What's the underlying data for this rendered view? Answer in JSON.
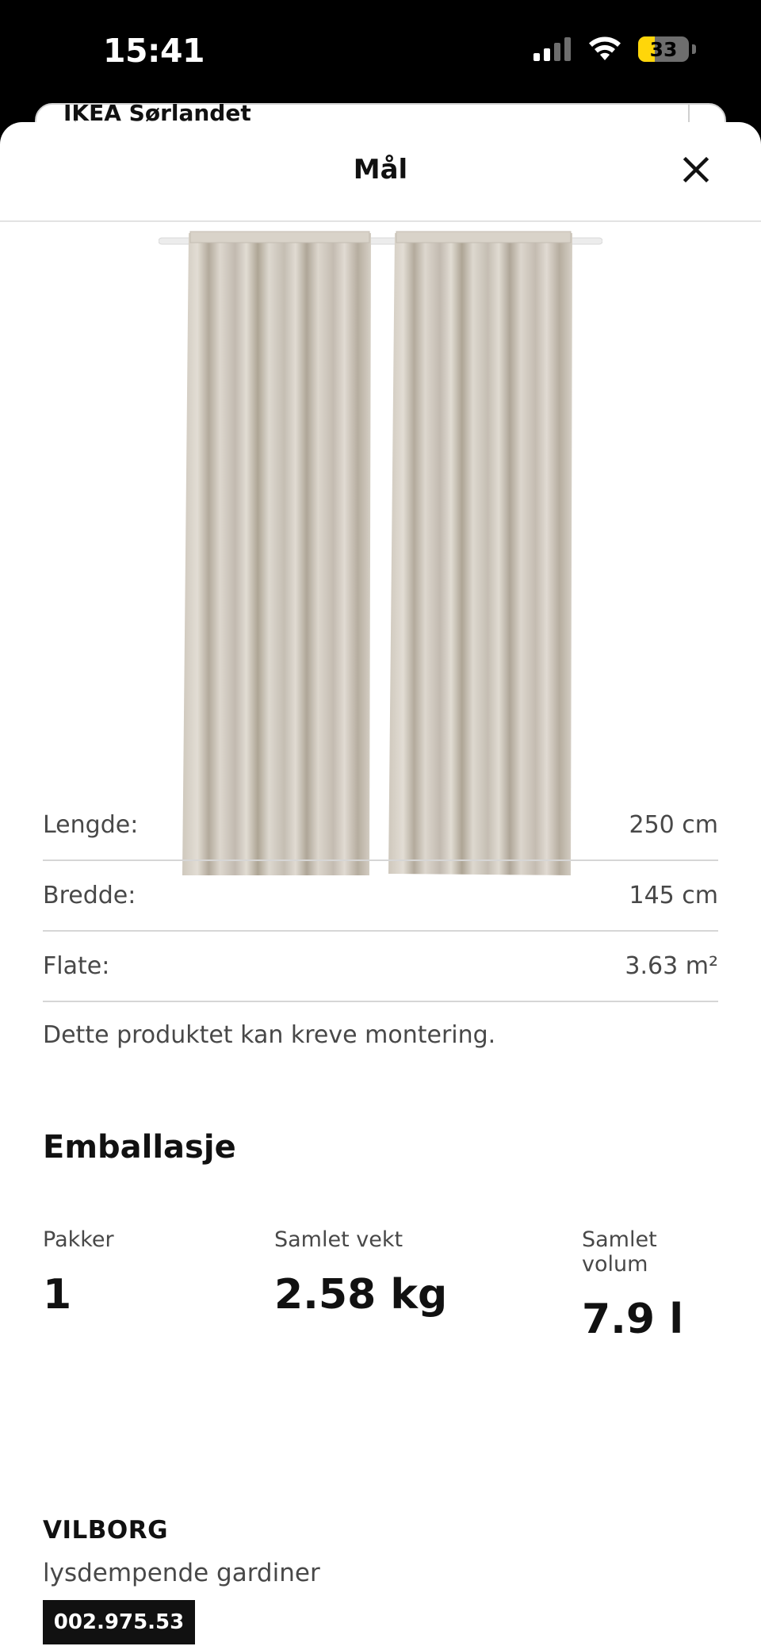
{
  "status_bar": {
    "time": "15:41",
    "battery_percent": "33",
    "battery_level": 0.33,
    "icons": [
      "cellular-signal-icon",
      "wifi-icon",
      "battery-icon"
    ]
  },
  "background_page": {
    "store_name": "IKEA Sørlandet"
  },
  "sheet": {
    "title": "Mål",
    "close_icon": "close-icon"
  },
  "dimensions": [
    {
      "label": "Lengde:",
      "value": "250 cm"
    },
    {
      "label": "Bredde:",
      "value": "145 cm"
    },
    {
      "label": "Flate:",
      "value": "3.63 m²"
    }
  ],
  "note": "Dette produktet kan kreve montering.",
  "packaging": {
    "title": "Emballasje",
    "stats": [
      {
        "label": "Pakker",
        "value": "1"
      },
      {
        "label": "Samlet vekt",
        "value": "2.58 kg"
      },
      {
        "label": "Samlet volum",
        "value": "7.9 l"
      }
    ]
  },
  "product": {
    "name": "VILBORG",
    "description": "lysdempende gardiner",
    "article_number": "002.975.53"
  },
  "colors": {
    "curtain": "#d8d2c8",
    "text_secondary": "#484848",
    "divider": "#d6d6d6"
  }
}
